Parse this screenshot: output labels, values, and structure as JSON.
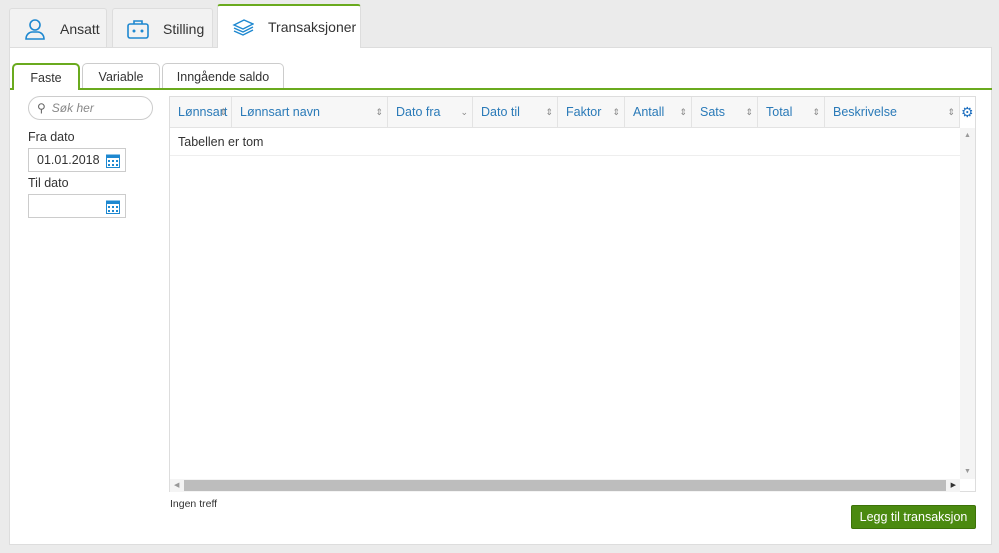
{
  "top_tabs": [
    {
      "label": "Ansatt",
      "icon": "user-icon"
    },
    {
      "label": "Stilling",
      "icon": "briefcase-icon"
    },
    {
      "label": "Transaksjoner",
      "icon": "money-stack-icon",
      "active": true
    }
  ],
  "sub_tabs": [
    {
      "label": "Faste",
      "active": true
    },
    {
      "label": "Variable"
    },
    {
      "label": "Inngående saldo"
    }
  ],
  "filters": {
    "search_placeholder": "Søk her",
    "fra_dato_label": "Fra dato",
    "fra_dato_value": "01.01.2018",
    "til_dato_label": "Til dato",
    "til_dato_value": ""
  },
  "table": {
    "columns": [
      "Lønnsart",
      "Lønnsart navn",
      "Dato fra",
      "Dato til",
      "Faktor",
      "Antall",
      "Sats",
      "Total",
      "Beskrivelse"
    ],
    "empty_text": "Tabellen er tom"
  },
  "status_text": "Ingen treff",
  "add_button": "Legg til transaksjon",
  "colors": {
    "accent": "#6aaa1e",
    "button": "#4b8a10",
    "link": "#2a7ab8"
  }
}
